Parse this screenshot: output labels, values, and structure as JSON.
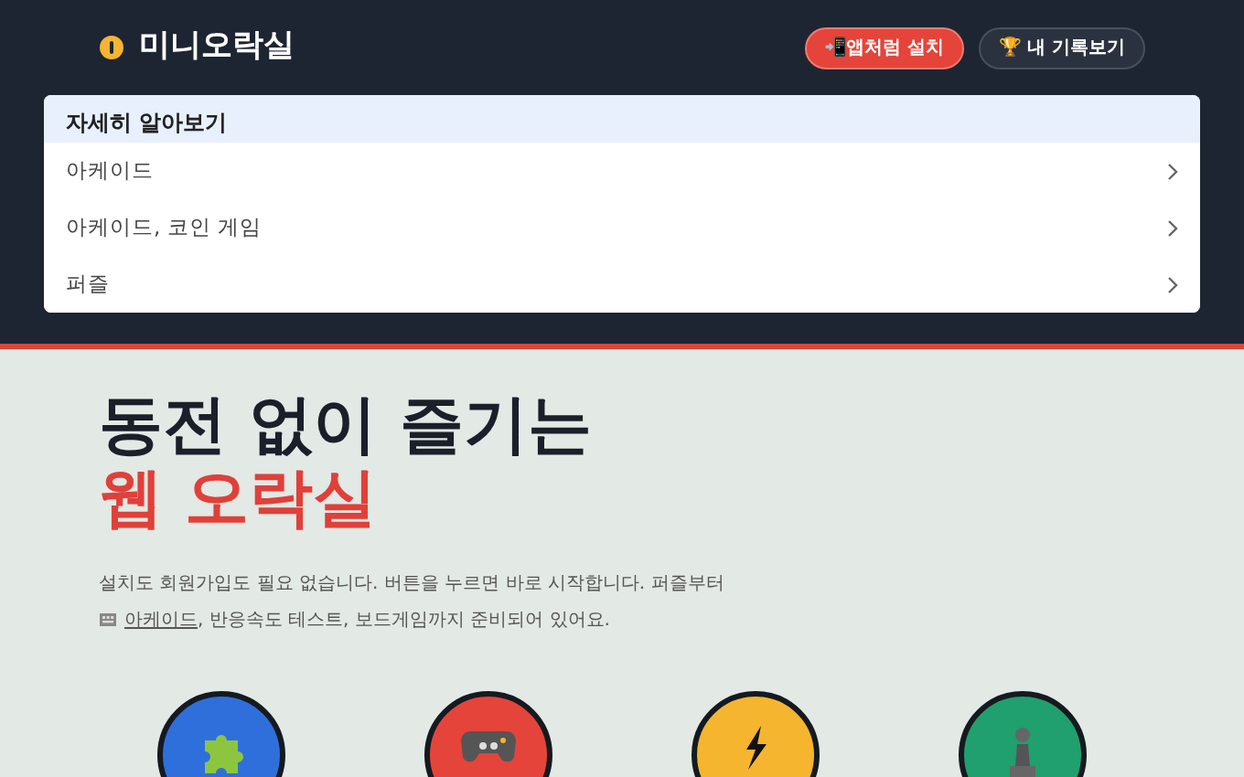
{
  "header": {
    "logo_text": "미니오락실",
    "buttons": [
      {
        "kind": "install",
        "label": "📲앱처럼 설치"
      },
      {
        "kind": "records",
        "label": "🏆 내 기록보기"
      }
    ]
  },
  "learn_more": {
    "title": "자세히 알아보기",
    "items": [
      {
        "label": "아케이드"
      },
      {
        "label": "아케이드, 코인 게임"
      },
      {
        "label": "퍼즐"
      }
    ]
  },
  "hero": {
    "headline": "동전 없이 즐기는",
    "highlight": "웹 오락실",
    "description_1": "설치도 회원가입도 필요 없습니다. 버튼을 누르면 바로 시작합니다. 퍼즐부터",
    "description_link": "아케이드",
    "description_2": ", 반응속도 테스트, 보드게임까지 준비되어 있어요."
  },
  "categories": [
    {
      "kind": "puzzle",
      "color": "#2f6fdc"
    },
    {
      "kind": "gamepad",
      "color": "#e5443a"
    },
    {
      "kind": "bolt",
      "color": "#f5b52e"
    },
    {
      "kind": "pawn",
      "color": "#1fa06e"
    }
  ]
}
